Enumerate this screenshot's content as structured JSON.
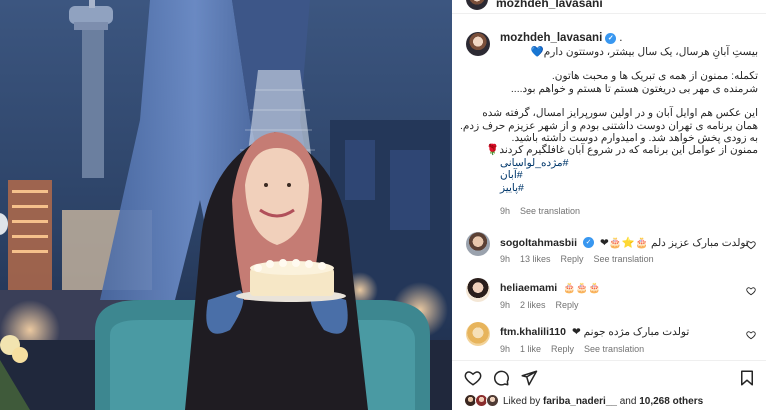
{
  "header": {
    "username": "mozhdeh_lavasani"
  },
  "post": {
    "username": "mozhdeh_lavasani",
    "verified_icon": "verified-badge-icon",
    "caption_lines": [
      "بیستِ آبانِ هرسال، یک سال بیشتر، دوستتون دارم💙",
      "",
      "تکمله: ممنون از همه ی تبریک ها و محبت هاتون.",
      "شرمنده ی مهر بی دریغتون هستم تا هستم و خواهم بود....",
      "",
      "این عکس هم اوایل آبان و در اولین سورپرایز امسال، گرفته شده",
      "همان برنامه ی تهران دوست داشتنی بودم و از شهر عزیزم حرف زدم.",
      "به زودی پخش خواهد شد. و امیدوارم دوست داشته باشید.",
      "ممنون از عوامل این برنامه که در شروع آبان غافلگیرم کردند🌹"
    ],
    "hashtags": [
      "#مژده_لواسانی",
      "#آبان",
      "#پاییز"
    ],
    "time": "9h",
    "see_translation": "See translation"
  },
  "comments": [
    {
      "username": "sogoltahmasbii",
      "verified": true,
      "text": "تولدت مبارک عزیز دلم 🎂⭐🎂❤",
      "time": "9h",
      "likes": "13 likes",
      "reply": "Reply",
      "see_translation": "See translation"
    },
    {
      "username": "heliaemami",
      "verified": false,
      "text": "🎂🎂🎂",
      "time": "9h",
      "likes": "2 likes",
      "reply": "Reply",
      "see_translation": ""
    },
    {
      "username": "ftm.khalili110",
      "verified": false,
      "text": "تولدت مبارک مژده جونم ❤",
      "time": "9h",
      "likes": "1 like",
      "reply": "Reply",
      "see_translation": "See translation"
    }
  ],
  "actions": {
    "icons": [
      "heart-icon",
      "comment-icon",
      "share-icon",
      "bookmark-icon"
    ]
  },
  "likes_summary": {
    "prefix": "Liked by ",
    "user": "fariba_naderi__",
    "middle": " and ",
    "count": "10,268 others"
  },
  "colors": {
    "verified": "#3897f0",
    "hashtag": "#00376b",
    "muted": "#737373",
    "heart": "#ed4956"
  }
}
